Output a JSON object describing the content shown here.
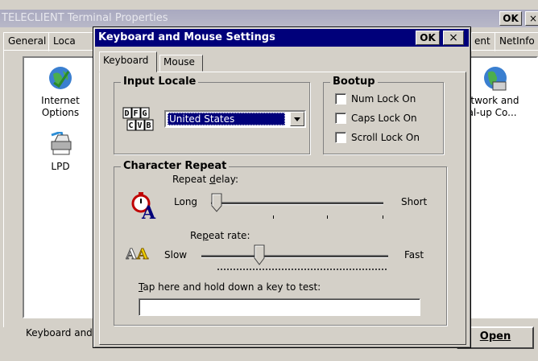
{
  "background_window": {
    "title": "TELECLIENT Terminal Properties",
    "ok_label": "OK",
    "close_label": "×",
    "tabs": [
      "General",
      "Loca",
      "ent",
      "NetInfo"
    ],
    "items": [
      {
        "label_line1": "Internet",
        "label_line2": "Options",
        "icon": "internet-options-icon"
      },
      {
        "label_line1": "LPD",
        "label_line2": "",
        "icon": "printer-icon"
      },
      {
        "label_line1": "Network and",
        "label_line2": "Dial-up Co...",
        "icon": "network-globe-icon"
      }
    ],
    "status_text": "Keyboard and",
    "open_button": "Open"
  },
  "dialog": {
    "title": "Keyboard and Mouse Settings",
    "ok_label": "OK",
    "close_label": "×",
    "tabs": [
      {
        "label": "Keyboard",
        "selected": true
      },
      {
        "label": "Mouse",
        "selected": false
      }
    ],
    "input_locale": {
      "group_label": "Input Locale",
      "selected_value": "United States"
    },
    "bootup": {
      "group_label": "Bootup",
      "checkboxes": [
        {
          "label": "Num Lock On",
          "checked": false
        },
        {
          "label": "Caps Lock On",
          "checked": false
        },
        {
          "label": "Scroll Lock On",
          "checked": false
        }
      ]
    },
    "character_repeat": {
      "group_label": "Character Repeat",
      "delay": {
        "label_pre": "Repeat ",
        "label_u": "d",
        "label_post": "elay:",
        "min_label": "Long",
        "max_label": "Short",
        "value": 0.0
      },
      "rate": {
        "label_pre": "Re",
        "label_u": "p",
        "label_post": "eat rate:",
        "min_label": "Slow",
        "max_label": "Fast",
        "value": 0.3
      },
      "test_label_u": "T",
      "test_label_rest": "ap here and hold down a key to test:",
      "test_value": ""
    }
  },
  "colors": {
    "dialog_titlebar": "#00007a",
    "face": "#d4d0c8",
    "selection": "#00007a"
  }
}
